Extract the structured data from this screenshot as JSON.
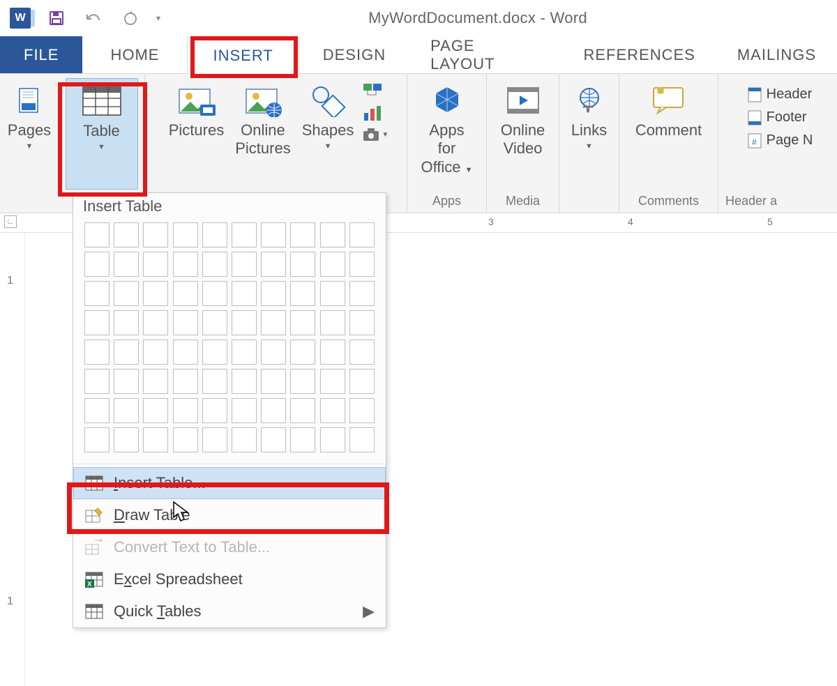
{
  "titlebar": {
    "app_glyph": "W",
    "document_title": "MyWordDocument.docx - Word"
  },
  "tabs": {
    "file": "FILE",
    "home": "HOME",
    "insert": "INSERT",
    "design": "DESIGN",
    "page_layout": "PAGE LAYOUT",
    "references": "REFERENCES",
    "mailings": "MAILINGS"
  },
  "ribbon": {
    "pages": {
      "label": "Pages"
    },
    "table": {
      "label": "Table"
    },
    "pictures": {
      "label": "Pictures"
    },
    "online_pictures": {
      "label_line1": "Online",
      "label_line2": "Pictures"
    },
    "shapes": {
      "label": "Shapes"
    },
    "apps": {
      "label_line1": "Apps for",
      "label_line2": "Office",
      "caption": "Apps"
    },
    "video": {
      "label_line1": "Online",
      "label_line2": "Video",
      "caption": "Media"
    },
    "links": {
      "label": "Links"
    },
    "comment": {
      "label": "Comment",
      "caption": "Comments"
    },
    "headerfooter": {
      "header": "Header",
      "footer": "Footer",
      "page_number_partial": "Page N",
      "caption_partial": "Header a"
    }
  },
  "table_dropdown": {
    "header": "Insert Table",
    "grid_rows": 8,
    "grid_cols": 10,
    "items": {
      "insert_table": "Insert Table...",
      "draw_table": "Draw Table",
      "convert": "Convert Text to Table...",
      "excel": "Excel Spreadsheet",
      "quick_tables": "Quick Tables"
    }
  },
  "ruler": {
    "n3": "3",
    "n4": "4",
    "n5": "5"
  },
  "vruler": {
    "n1a": "1",
    "n1b": "1"
  }
}
